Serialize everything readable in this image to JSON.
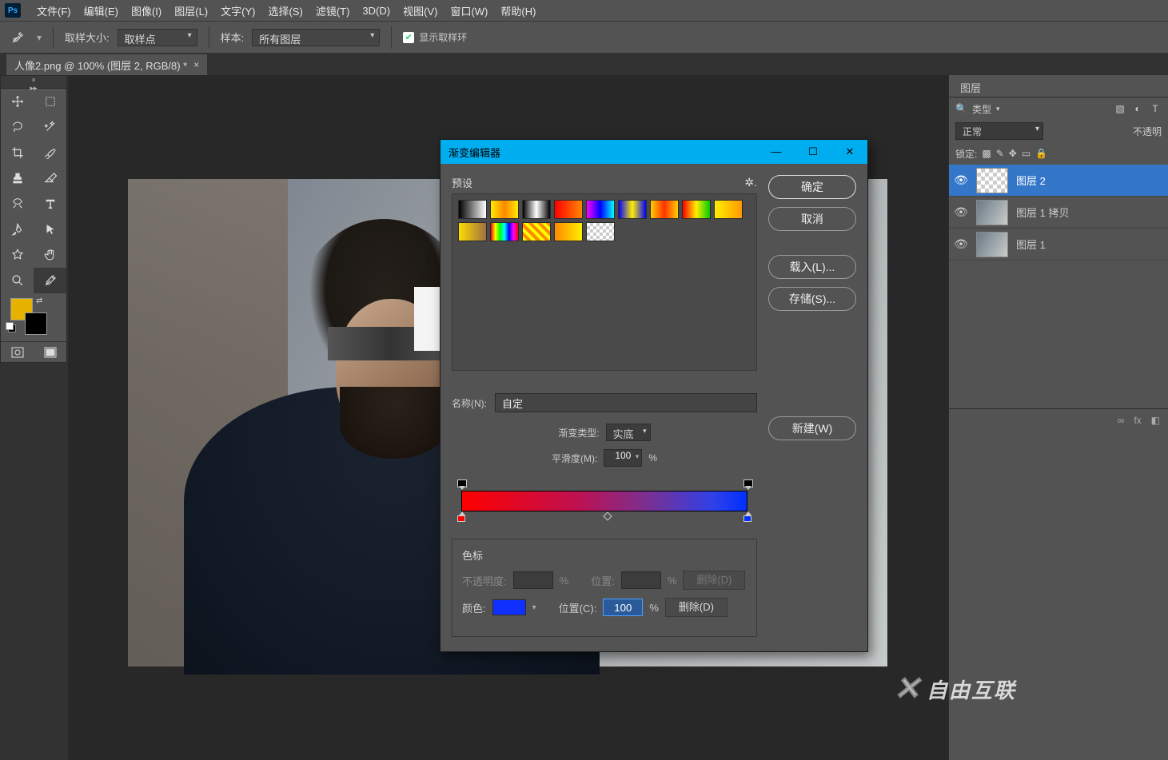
{
  "menubar": {
    "items": [
      "文件(F)",
      "编辑(E)",
      "图像(I)",
      "图层(L)",
      "文字(Y)",
      "选择(S)",
      "滤镜(T)",
      "3D(D)",
      "视图(V)",
      "窗口(W)",
      "帮助(H)"
    ]
  },
  "optbar": {
    "sample_size_label": "取样大小:",
    "sample_size_value": "取样点",
    "sample_label": "样本:",
    "sample_value": "所有图层",
    "show_ring": "显示取样环"
  },
  "doc_tab": {
    "title": "人像2.png @ 100% (图层 2, RGB/8) *"
  },
  "layers_panel": {
    "tab": "图层",
    "search_placeholder": "类型",
    "blend_mode": "正常",
    "opacity_label": "不透明",
    "lock_label": "锁定:",
    "items": [
      {
        "name": "图层 2",
        "selected": true,
        "thumb": "checker"
      },
      {
        "name": "图层 1 拷贝",
        "selected": false,
        "thumb": "photo"
      },
      {
        "name": "图层 1",
        "selected": false,
        "thumb": "photo"
      }
    ],
    "foot_icons": [
      "∞",
      "fx",
      "◧"
    ]
  },
  "gradient_editor": {
    "title": "渐变编辑器",
    "presets_label": "预设",
    "buttons": {
      "ok": "确定",
      "cancel": "取消",
      "load": "载入(L)...",
      "save": "存储(S)...",
      "new": "新建(W)"
    },
    "name_label": "名称(N):",
    "name_value": "自定",
    "type_label": "渐变类型:",
    "type_value": "实底",
    "smooth_label": "平滑度(M):",
    "smooth_value": "100",
    "smooth_unit": "%",
    "stops_heading": "色标",
    "opacity_row": {
      "label": "不透明度:",
      "unit": "%",
      "pos_label": "位置:",
      "pos_unit": "%",
      "delete": "删除(D)"
    },
    "color_row": {
      "label": "颜色:",
      "swatch": "#1030ff",
      "pos_label": "位置(C):",
      "pos_value": "100",
      "pos_unit": "%",
      "delete": "删除(D)"
    },
    "gradient": {
      "left": "#ff0000",
      "right": "#0030ff"
    },
    "presets": [
      "linear-gradient(90deg,#000,#fff)",
      "linear-gradient(90deg,#ffea00,#ff8800,#ffea00)",
      "linear-gradient(90deg,#000,#fff,#000)",
      "linear-gradient(90deg,#ff0000,#ff8800)",
      "linear-gradient(90deg,#ff00ff,#0000ff,#00ffff)",
      "linear-gradient(90deg,#0000ff,#ffee00,#0000ff)",
      "linear-gradient(90deg,#ffcc00,#ff3300,#ffcc00)",
      "linear-gradient(90deg,#ff0000,#ffee00,#00cc00)",
      "linear-gradient(90deg,#ffee00,#ff9900)",
      "linear-gradient(90deg,#ffdd00,#a07040)",
      "linear-gradient(90deg,#ff0000,#ffff00,#00ff00,#00ffff,#0000ff,#ff00ff,#ff0000)",
      "repeating-linear-gradient(45deg,#ff0 0 4px,#f80 4px 8px)",
      "linear-gradient(90deg,#ff8800,#ffee00)",
      "repeating-conic-gradient(#ccc 0 25%,#fff 0 50%)"
    ]
  },
  "watermark": "自由互联",
  "colors": {
    "fg": "#e8b200",
    "bg": "#000000",
    "accent": "#00aef0"
  }
}
